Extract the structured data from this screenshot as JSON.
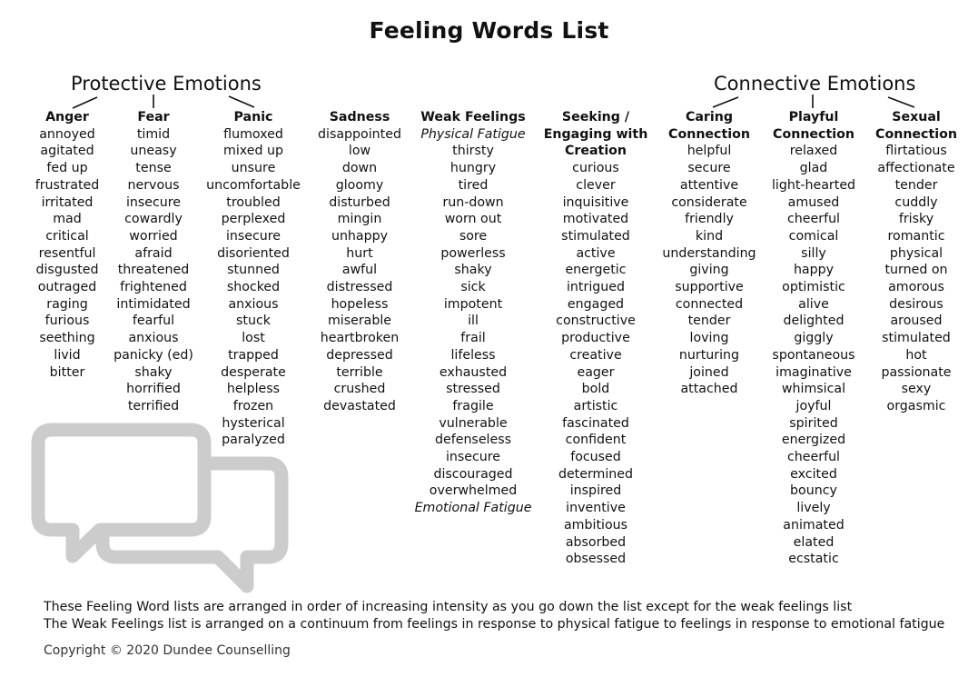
{
  "title": "Feeling Words List",
  "groups": {
    "protective": "Protective Emotions",
    "connective": "Connective Emotions"
  },
  "columns": [
    {
      "header": [
        "Anger"
      ],
      "words": [
        "annoyed",
        "agitated",
        "fed up",
        "frustrated",
        "irritated",
        "mad",
        "critical",
        "resentful",
        "disgusted",
        "outraged",
        "raging",
        "furious",
        "seething",
        "livid",
        "bitter"
      ]
    },
    {
      "header": [
        "Fear"
      ],
      "words": [
        "timid",
        "uneasy",
        "tense",
        "nervous",
        "insecure",
        "cowardly",
        "worried",
        "afraid",
        "threatened",
        "frightened",
        "intimidated",
        "fearful",
        "anxious",
        "panicky (ed)",
        "shaky",
        "horrified",
        "terrified"
      ]
    },
    {
      "header": [
        "Panic"
      ],
      "words": [
        "flumoxed",
        "mixed up",
        "unsure",
        "uncomfortable",
        "troubled",
        "perplexed",
        "insecure",
        "disoriented",
        "stunned",
        "shocked",
        "anxious",
        "stuck",
        "lost",
        "trapped",
        "desperate",
        "helpless",
        "frozen",
        "hysterical",
        "paralyzed"
      ]
    },
    {
      "header": [
        "Sadness"
      ],
      "words": [
        "disappointed",
        "low",
        "down",
        "gloomy",
        "disturbed",
        "mingin",
        "unhappy",
        "hurt",
        "awful",
        "distressed",
        "hopeless",
        "miserable",
        "heartbroken",
        "depressed",
        "terrible",
        "crushed",
        "devastated"
      ]
    },
    {
      "header": [
        "Weak Feelings"
      ],
      "subheader_top": "Physical Fatigue",
      "words": [
        "thirsty",
        "hungry",
        "tired",
        "run-down",
        "worn out",
        "sore",
        "powerless",
        "shaky",
        "sick",
        "impotent",
        "ill",
        "frail",
        "lifeless",
        "exhausted",
        "stressed",
        "fragile",
        "vulnerable",
        "defenseless",
        "insecure",
        "discouraged",
        "overwhelmed"
      ],
      "subheader_bottom": "Emotional Fatigue"
    },
    {
      "header": [
        "Seeking /",
        "Engaging with",
        "Creation"
      ],
      "words": [
        "curious",
        "clever",
        "inquisitive",
        "motivated",
        "stimulated",
        "active",
        "energetic",
        "intrigued",
        "engaged",
        "constructive",
        "productive",
        "creative",
        "eager",
        "bold",
        "artistic",
        "fascinated",
        "confident",
        "focused",
        "determined",
        "inspired",
        "inventive",
        "ambitious",
        "absorbed",
        "obsessed"
      ]
    },
    {
      "header": [
        "Caring",
        "Connection"
      ],
      "words": [
        "helpful",
        "secure",
        "attentive",
        "considerate",
        "friendly",
        "kind",
        "understanding",
        "giving",
        "supportive",
        "connected",
        "tender",
        "loving",
        "nurturing",
        "joined",
        "attached"
      ]
    },
    {
      "header": [
        "Playful",
        "Connection"
      ],
      "words": [
        "relaxed",
        "glad",
        "light-hearted",
        "amused",
        "cheerful",
        "comical",
        "silly",
        "happy",
        "optimistic",
        "alive",
        "delighted",
        "giggly",
        "spontaneous",
        "imaginative",
        "whimsical",
        "joyful",
        "spirited",
        "energized",
        "cheerful",
        "excited",
        "bouncy",
        "lively",
        "animated",
        "elated",
        "ecstatic"
      ]
    },
    {
      "header": [
        "Sexual",
        "Connection"
      ],
      "words": [
        "flirtatious",
        "affectionate",
        "tender",
        "cuddly",
        "frisky",
        "romantic",
        "physical",
        "turned on",
        "amorous",
        "desirous",
        "aroused",
        "stimulated",
        "hot",
        "passionate",
        "sexy",
        "orgasmic"
      ]
    }
  ],
  "notes": [
    "These Feeling Word lists are arranged in order of increasing intensity as you go down the list except for the weak feelings list",
    "The Weak Feelings list is arranged on a continuum from feelings in response to physical fatigue to feelings in response to emotional fatigue"
  ],
  "copyright": "Copyright © 2020 Dundee Counselling",
  "icon": "speech-bubbles-icon",
  "colors": {
    "text": "#111111",
    "icon": "#cccccc",
    "background": "#ffffff"
  }
}
